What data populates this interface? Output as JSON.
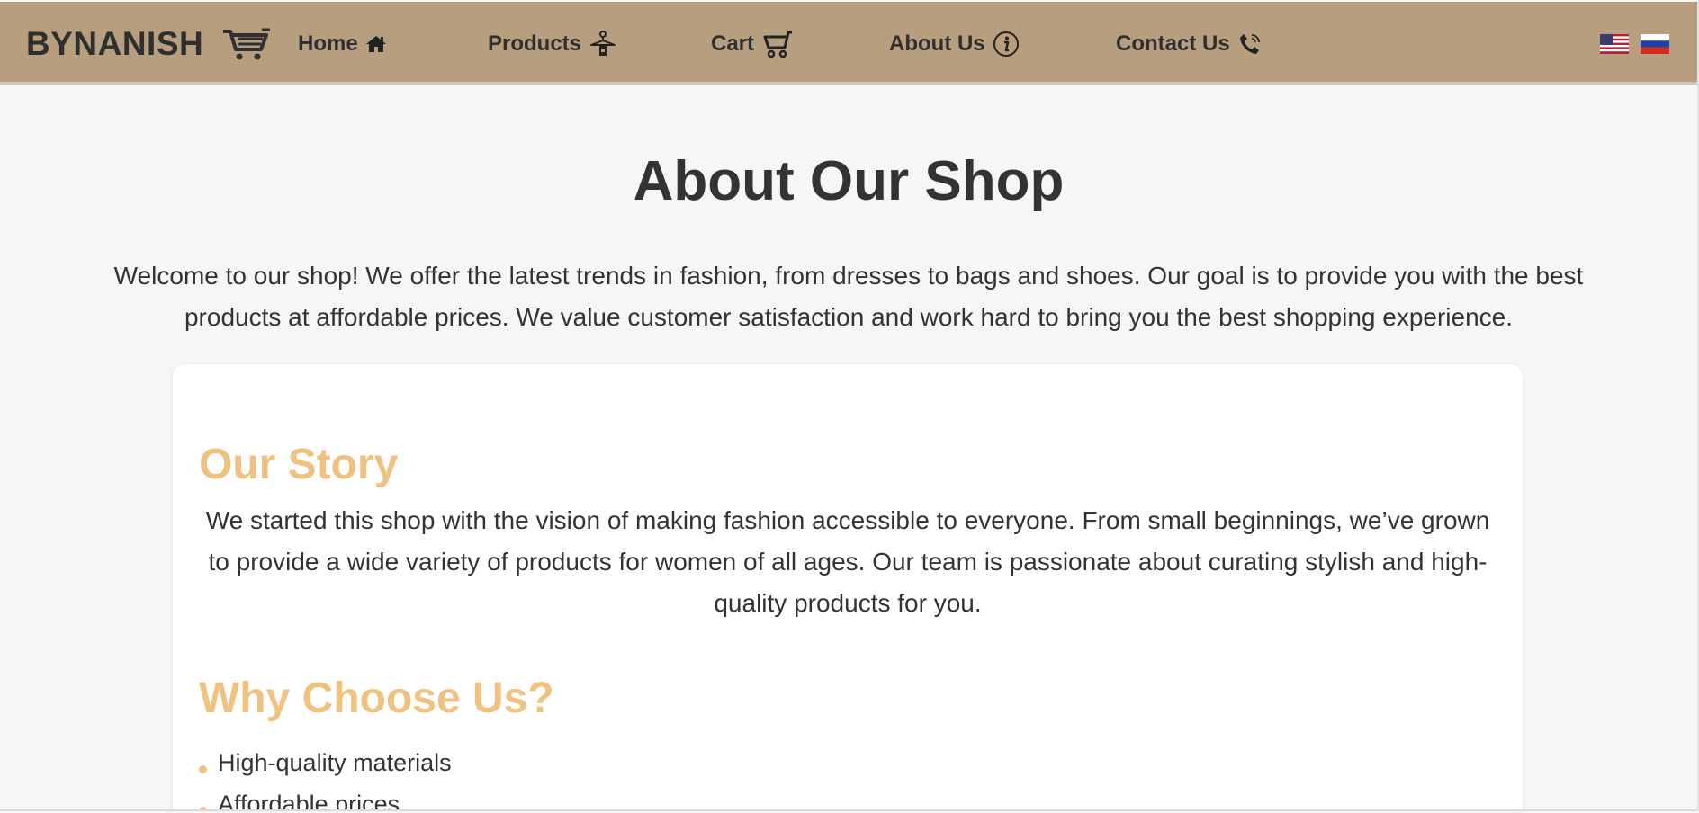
{
  "header": {
    "brand": "BYNANISH",
    "nav": [
      {
        "label": "Home",
        "icon": "home-icon"
      },
      {
        "label": "Products",
        "icon": "hanger-icon"
      },
      {
        "label": "Cart",
        "icon": "cart-icon"
      },
      {
        "label": "About Us",
        "icon": "info-icon"
      },
      {
        "label": "Contact Us",
        "icon": "phone-icon"
      }
    ],
    "languages": [
      {
        "icon": "us-flag-icon"
      },
      {
        "icon": "ru-flag-icon"
      }
    ]
  },
  "page": {
    "title": "About Our Shop",
    "intro": "Welcome to our shop! We offer the latest trends in fashion, from dresses to bags and shoes. Our goal is to provide you with the best products at affordable prices. We value customer satisfaction and work hard to bring you the best shopping experience."
  },
  "story": {
    "title": "Our Story",
    "text": "We started this shop with the vision of making fashion accessible to everyone. From small beginnings, we’ve grown to provide a wide variety of products for women of all ages. Our team is passionate about curating stylish and high-quality products for you."
  },
  "why": {
    "title": "Why Choose Us?",
    "items": [
      "High-quality materials",
      "Affordable prices"
    ]
  },
  "colors": {
    "navbar": "#b69e7e",
    "accent": "#f0c282",
    "text": "#333333",
    "background": "#f6f6f6"
  }
}
